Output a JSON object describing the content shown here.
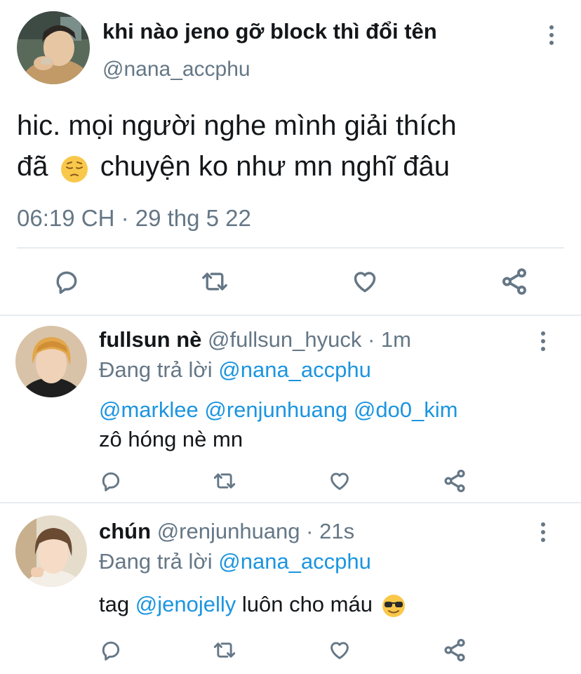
{
  "main_tweet": {
    "display_name": "khi nào jeno gỡ block thì đổi tên",
    "handle": "@nana_accphu",
    "text_line1": "hic. mọi người nghe mình giải thích",
    "text_line2_a": "đã",
    "text_line2_b": "chuyện ko như mn nghĩ đâu",
    "emoji": "pensive-face",
    "timestamp": "06:19 CH · 29 thg 5 22"
  },
  "replies": [
    {
      "display_name": "fullsun nè",
      "handle": "@fullsun_hyuck",
      "time": "· 1m",
      "replying_prefix": "Đang trả lời",
      "replying_to": "@nana_accphu",
      "mentions": [
        "@marklee",
        "@renjunhuang",
        "@do0_kim"
      ],
      "text": "zô hóng nè mn"
    },
    {
      "display_name": "chún",
      "handle": "@renjunhuang",
      "time": "· 21s",
      "replying_prefix": "Đang trả lời",
      "replying_to": "@nana_accphu",
      "text_a": "tag",
      "mention": "@jenojelly",
      "text_b": "luôn cho máu",
      "emoji": "smiling-face-with-sunglasses"
    }
  ],
  "icons": [
    "reply-icon",
    "retweet-icon",
    "like-icon",
    "share-icon",
    "more-icon"
  ],
  "colors": {
    "link": "#1b95e0",
    "muted": "#657786",
    "divider": "#e6ecf0"
  }
}
